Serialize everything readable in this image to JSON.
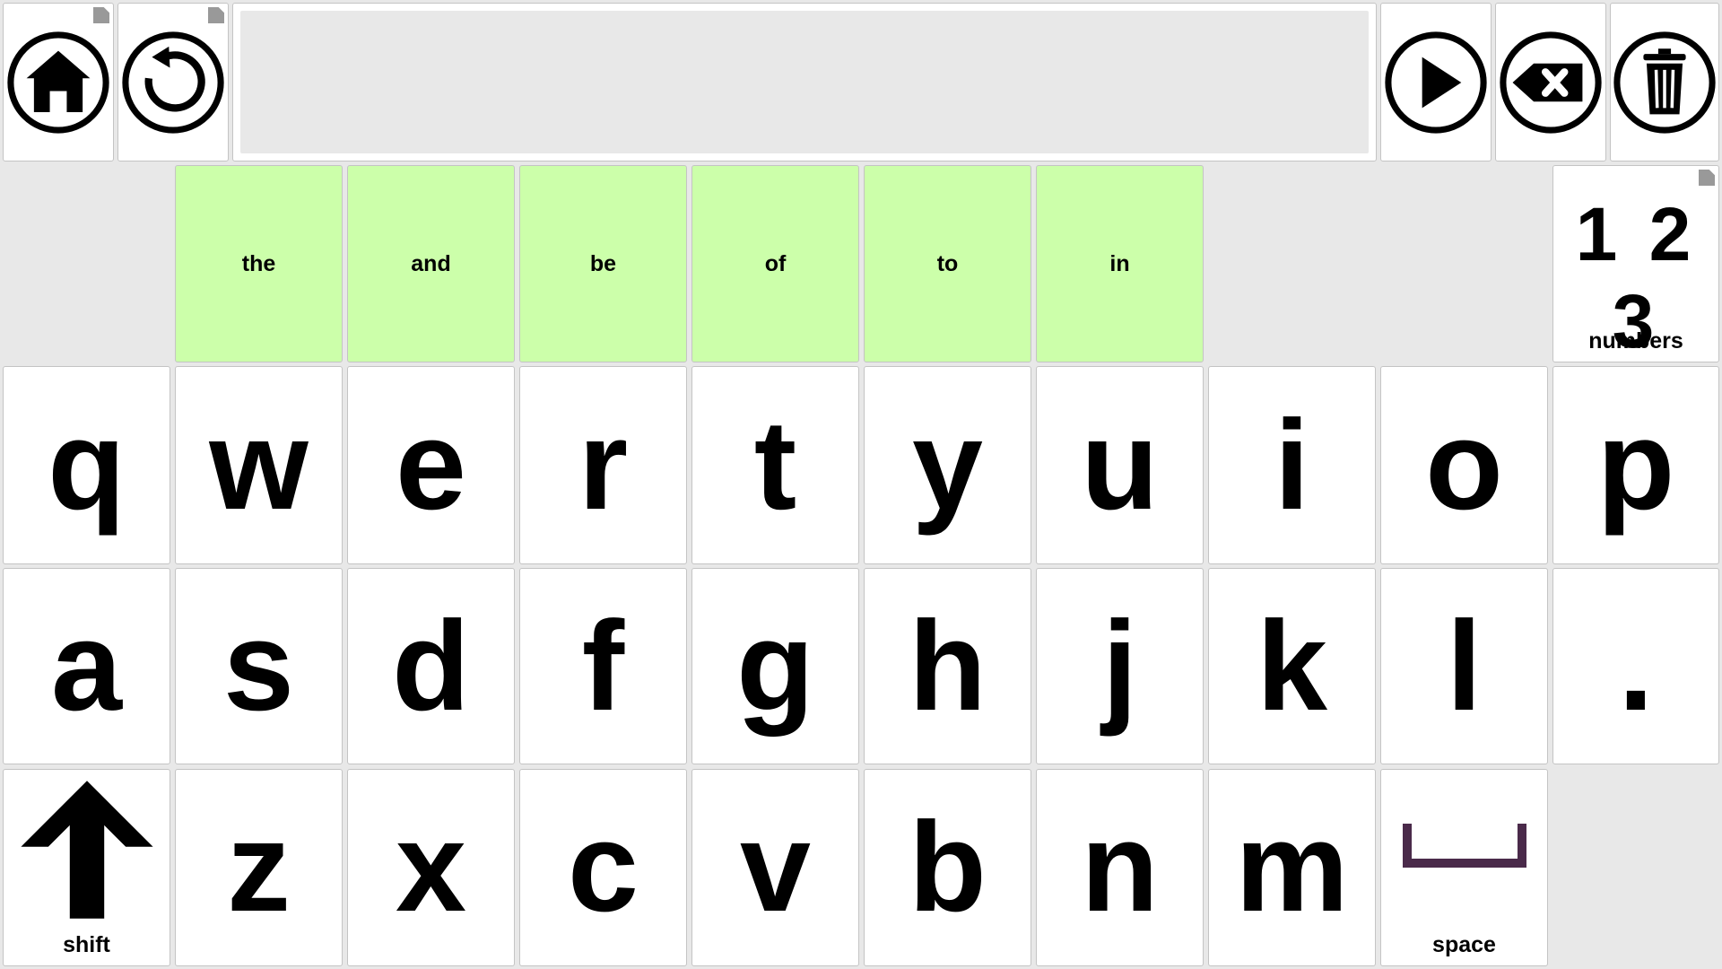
{
  "message_bar": {
    "text": ""
  },
  "suggestions": [
    "the",
    "and",
    "be",
    "of",
    "to",
    "in"
  ],
  "numbers": {
    "glyph": "1 2 3",
    "label": "numbers"
  },
  "rows": [
    [
      "q",
      "w",
      "e",
      "r",
      "t",
      "y",
      "u",
      "i",
      "o",
      "p"
    ],
    [
      "a",
      "s",
      "d",
      "f",
      "g",
      "h",
      "j",
      "k",
      "l",
      "."
    ],
    [
      "z",
      "x",
      "c",
      "v",
      "b",
      "n",
      "m"
    ]
  ],
  "shift": {
    "label": "shift"
  },
  "space": {
    "label": "space"
  },
  "colors": {
    "suggestion_bg": "#ccffaa",
    "key_bg": "#ffffff",
    "page_bg": "#e8e8e8",
    "space_icon": "#4a2a4a"
  },
  "icons": {
    "home": "home-icon",
    "back": "back-icon",
    "speak": "speak-icon",
    "backspace": "backspace-icon",
    "clear": "trash-icon"
  }
}
